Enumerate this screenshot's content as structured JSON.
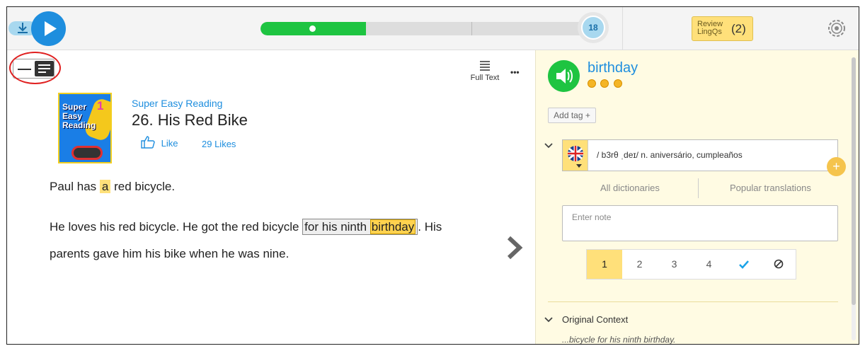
{
  "top": {
    "progress_count": "18",
    "review_l1": "Review",
    "review_l2": "LingQs",
    "review_count": "(2)"
  },
  "toolbar": {
    "full_text": "Full Text",
    "more": "•••"
  },
  "lesson": {
    "course": "Super Easy Reading",
    "title": "26. His Red Bike",
    "cover": {
      "l1": "Super",
      "l2": "Easy",
      "l3": "Reading",
      "num": "1"
    },
    "like": "Like",
    "likes": "29 Likes",
    "p1": {
      "a": "Paul has ",
      "b": "a",
      "c": " red bicycle."
    },
    "p2": {
      "a": "He loves his red bicycle. He got the red bicycle ",
      "phrase": "for his ninth ",
      "word": "birthday",
      "c": ". His",
      "line2": "parents gave him his bike when he was nine."
    }
  },
  "panel": {
    "word": "birthday",
    "add_tag": "Add tag +",
    "hint": "/ b3rθ ˌdeɪ/ n. aniversário, cumpleaños",
    "all_dict": "All dictionaries",
    "popular": "Popular translations",
    "note_placeholder": "Enter note",
    "statuses": [
      "1",
      "2",
      "3",
      "4"
    ],
    "context_label": "Original Context",
    "context": "...bicycle for his ninth birthday."
  }
}
